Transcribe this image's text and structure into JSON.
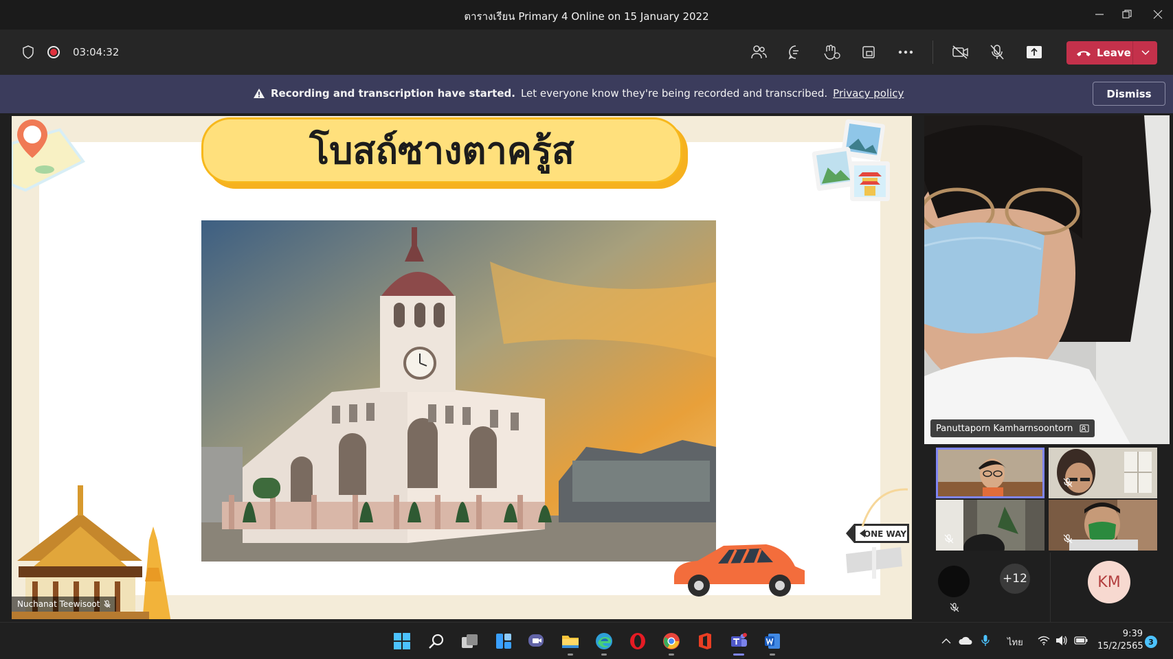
{
  "window": {
    "title": "ตารางเรียน Primary 4 Online on 15 January 2022",
    "minimize_icon": "minimize-icon",
    "restore_icon": "restore-icon",
    "close_icon": "close-icon"
  },
  "toolbar": {
    "timer": "03:04:32",
    "icons": [
      "shield-icon",
      "recording-icon",
      "people-icon",
      "chat-icon",
      "react-icon",
      "rooms-icon",
      "more-icon",
      "camera-off-icon",
      "mic-off-icon",
      "share-icon"
    ],
    "leave_label": "Leave",
    "leave_color": "#c4314b"
  },
  "banner": {
    "bold_text": "Recording and transcription have started.",
    "text": "Let everyone know they're being recorded and transcribed.",
    "link": "Privacy policy",
    "dismiss_label": "Dismiss",
    "background": "#3b3c5c"
  },
  "slide": {
    "title": "โบสถ์ซางตาครู้ส",
    "sign_text": "ONE WAY",
    "presenter_name": "Nuchanat Teewisoot"
  },
  "participants": {
    "featured_name": "Panuttaporn Kamharnsoontorn",
    "overflow_count": "+12",
    "initials": "KM",
    "active_tile_color": "#7f85f5"
  },
  "taskbar": {
    "apps": [
      "windows-start-icon",
      "search-icon",
      "task-view-icon",
      "widgets-icon",
      "teams-chat-icon",
      "file-explorer-icon",
      "edge-icon",
      "opera-icon",
      "chrome-icon",
      "office-icon",
      "teams-icon",
      "word-icon"
    ],
    "language": "ไทย",
    "time": "9:39",
    "date": "15/2/2565",
    "notification_count": "3"
  }
}
